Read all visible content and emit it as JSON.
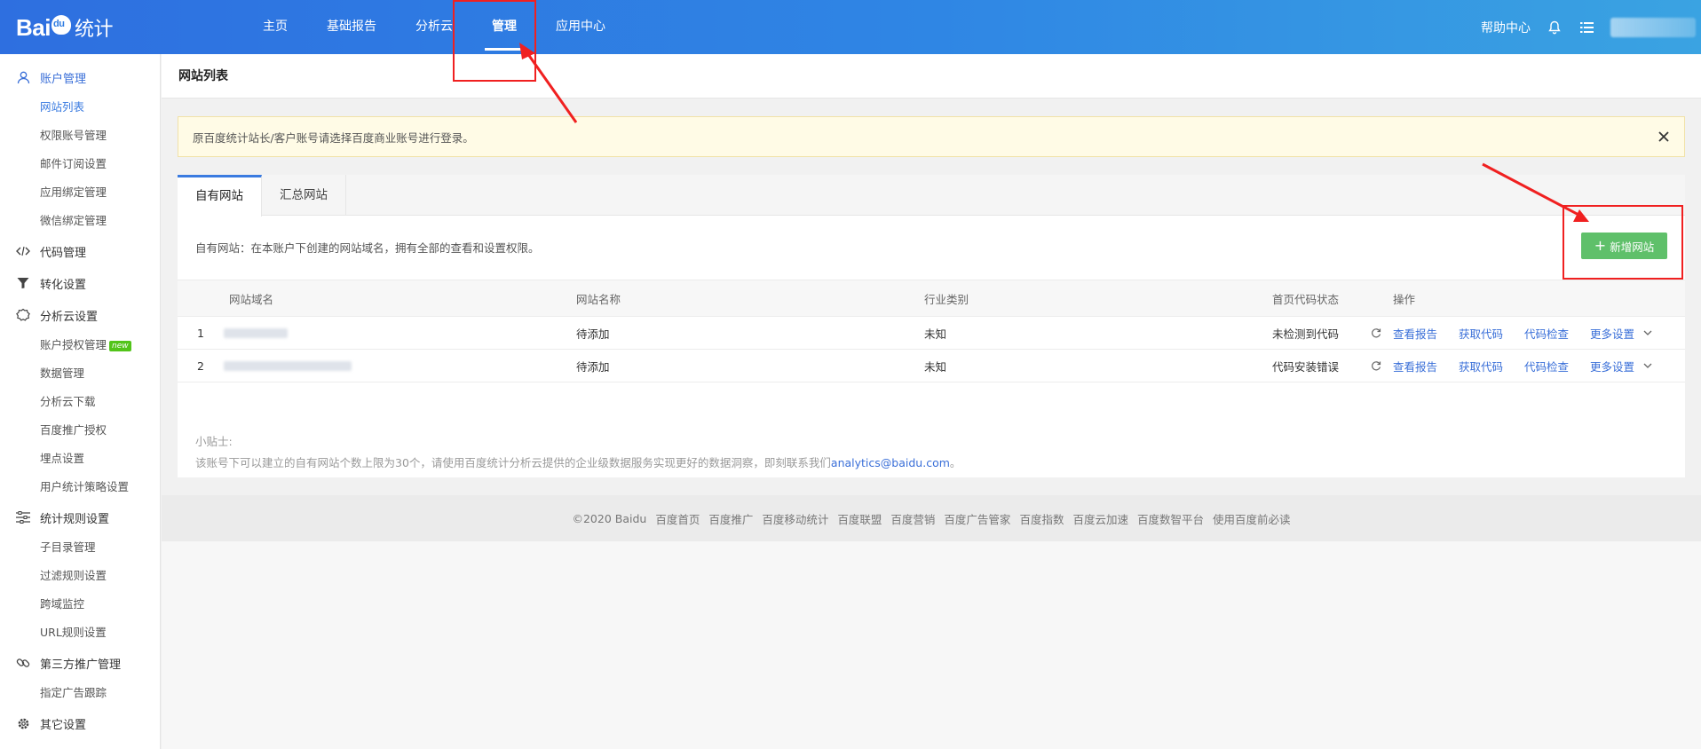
{
  "header": {
    "logo_text": "Bai",
    "logo_suffix": "统计",
    "nav": [
      "主页",
      "基础报告",
      "分析云",
      "管理",
      "应用中心"
    ],
    "active_nav": "管理",
    "help_label": "帮助中心",
    "bell_icon": "bell-icon",
    "menu_icon": "list-icon"
  },
  "sidebar": {
    "groups": [
      {
        "label": "账户管理",
        "icon": "user-icon",
        "active": true,
        "items": [
          "网站列表",
          "权限账号管理",
          "邮件订阅设置",
          "应用绑定管理",
          "微信绑定管理"
        ]
      },
      {
        "label": "代码管理",
        "icon": "code-icon",
        "items": []
      },
      {
        "label": "转化设置",
        "icon": "filter-icon",
        "items": []
      },
      {
        "label": "分析云设置",
        "icon": "cloud-icon",
        "items": [
          "账户授权管理",
          "数据管理",
          "分析云下载",
          "百度推广授权",
          "埋点设置",
          "用户统计策略设置"
        ]
      },
      {
        "label": "统计规则设置",
        "icon": "sliders-icon",
        "items": [
          "子目录管理",
          "过滤规则设置",
          "跨域监控",
          "URL规则设置"
        ]
      },
      {
        "label": "第三方推广管理",
        "icon": "link-icon",
        "items": [
          "指定广告跟踪"
        ]
      },
      {
        "label": "其它设置",
        "icon": "gear-icon",
        "items": []
      }
    ],
    "new_badge": "new",
    "active_item": "网站列表"
  },
  "page": {
    "title": "网站列表",
    "notice": "原百度统计站长/客户账号请选择百度商业账号进行登录。",
    "tabs": [
      "自有网站",
      "汇总网站"
    ],
    "active_tab": "自有网站",
    "tab_desc": "自有网站：在本账户下创建的网站域名，拥有全部的查看和设置权限。",
    "add_button": "新增网站"
  },
  "table": {
    "columns": [
      "网站域名",
      "网站名称",
      "行业类别",
      "首页代码状态",
      "操作"
    ],
    "rows": [
      {
        "index": "1",
        "name": "待添加",
        "industry": "未知",
        "status": "未检测到代码"
      },
      {
        "index": "2",
        "name": "待添加",
        "industry": "未知",
        "status": "代码安装错误"
      }
    ],
    "ops": [
      "查看报告",
      "获取代码",
      "代码检查",
      "更多设置"
    ]
  },
  "tips": {
    "title": "小贴士:",
    "text": "该账号下可以建立的自有网站个数上限为30个，请使用百度统计分析云提供的企业级数据服务实现更好的数据洞察，即刻联系我们",
    "email": "analytics@baidu.com",
    "end": "。"
  },
  "footer": [
    "©2020 Baidu",
    "百度首页",
    "百度推广",
    "百度移动统计",
    "百度联盟",
    "百度营销",
    "百度广告管家",
    "百度指数",
    "百度云加速",
    "百度数智平台",
    "使用百度前必读"
  ],
  "colors": {
    "accent": "#3a7be0",
    "header": "#2f86e4",
    "add_button": "#5fc06a",
    "highlight": "#f02020"
  }
}
